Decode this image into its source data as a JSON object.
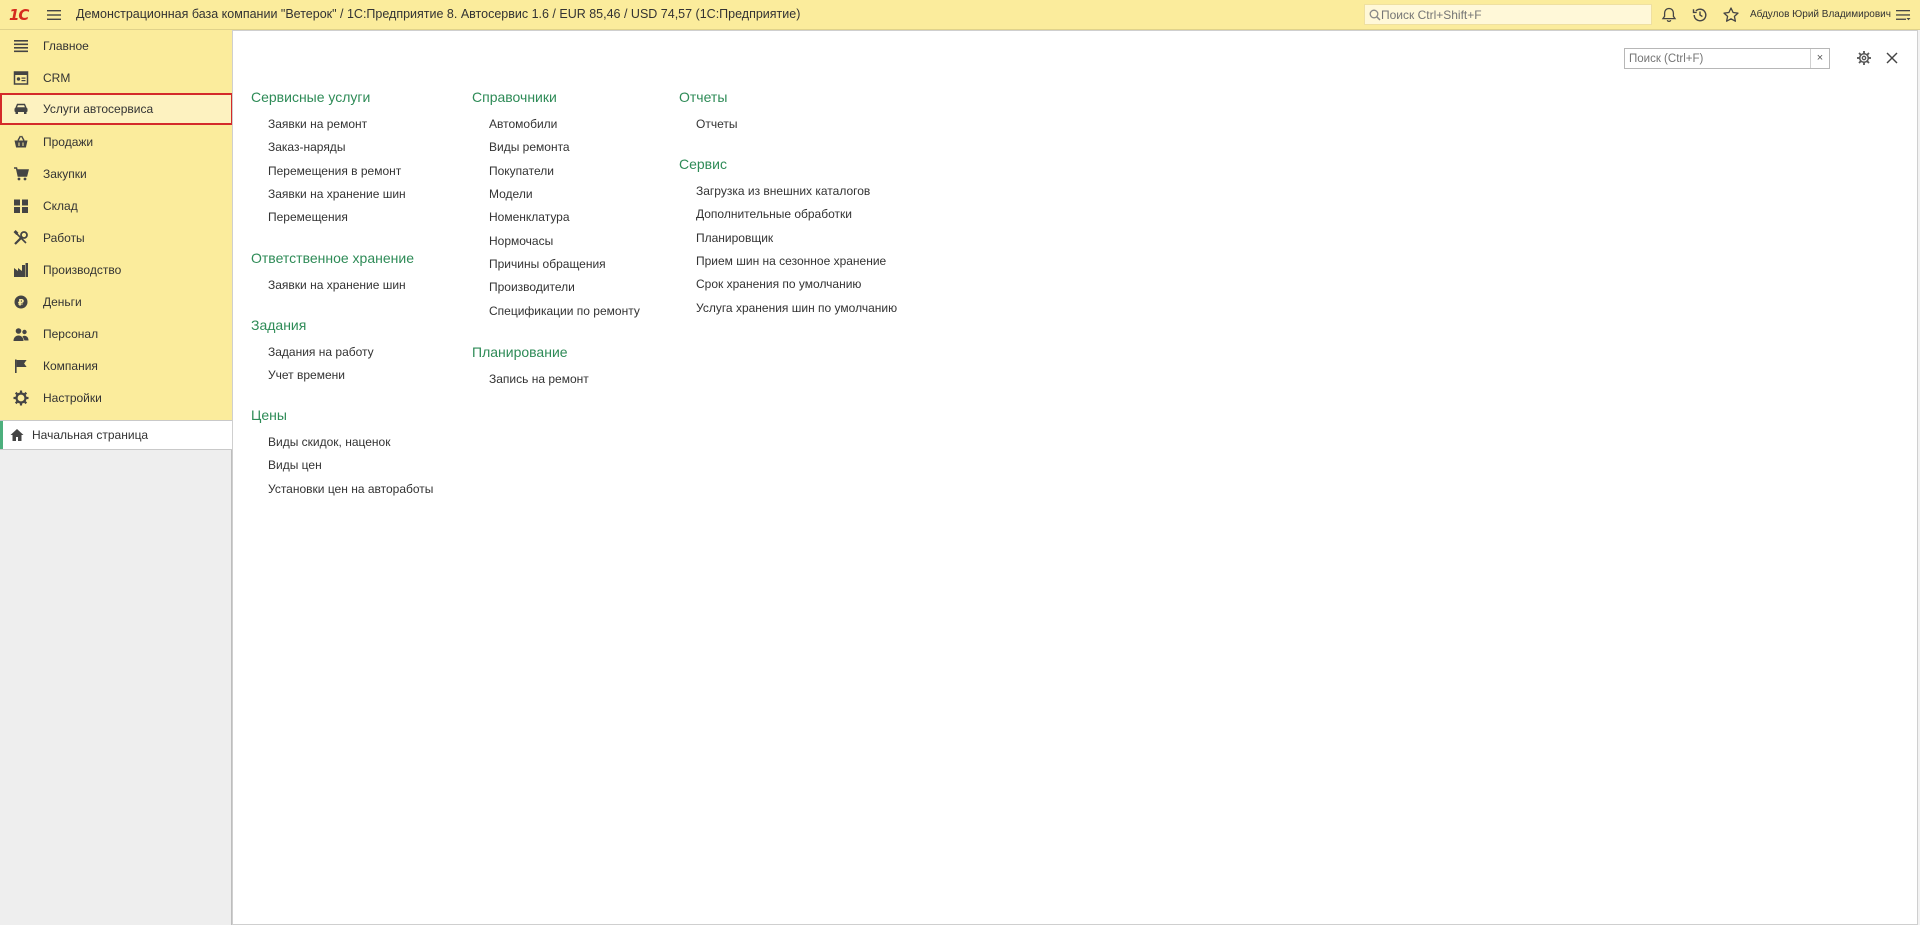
{
  "app": {
    "title": "Демонстрационная база компании \"Ветерок\" / 1С:Предприятие 8. Автосервис 1.6 / EUR 85,46 / USD 74,57  (1С:Предприятие)",
    "logo": "1С",
    "global_search_placeholder": "Поиск Ctrl+Shift+F",
    "user": "Абдулов Юрий Владимирович",
    "icons": [
      "menu-icon",
      "search-icon",
      "bell-icon",
      "history-icon",
      "star-icon",
      "settings-menu-icon"
    ]
  },
  "sidebar": {
    "items": [
      {
        "label": "Главное",
        "icon": "lines-icon"
      },
      {
        "label": "CRM",
        "icon": "crm-icon"
      },
      {
        "label": "Услуги автосервиса",
        "icon": "car-icon"
      },
      {
        "label": "Продажи",
        "icon": "basket-icon"
      },
      {
        "label": "Закупки",
        "icon": "cart-icon"
      },
      {
        "label": "Склад",
        "icon": "grid-icon"
      },
      {
        "label": "Работы",
        "icon": "tools-icon"
      },
      {
        "label": "Производство",
        "icon": "factory-icon"
      },
      {
        "label": "Деньги",
        "icon": "coin-icon"
      },
      {
        "label": "Персонал",
        "icon": "people-icon"
      },
      {
        "label": "Компания",
        "icon": "flag-icon"
      },
      {
        "label": "Настройки",
        "icon": "gear-icon"
      }
    ],
    "active_index": 2,
    "home_page": "Начальная страница"
  },
  "content": {
    "search_placeholder": "Поиск (Ctrl+F)",
    "clear_label": "×",
    "columns": [
      {
        "groups": [
          {
            "title": "Сервисные услуги",
            "links": [
              "Заявки на ремонт",
              "Заказ-наряды",
              "Перемещения в ремонт",
              "Заявки на хранение шин",
              "Перемещения"
            ]
          },
          {
            "title": "Ответственное хранение",
            "links": [
              "Заявки на хранение шин"
            ]
          },
          {
            "title": "Задания",
            "links": [
              "Задания на работу",
              "Учет времени"
            ]
          },
          {
            "title": "Цены",
            "links": [
              "Виды скидок, наценок",
              "Виды цен",
              "Установки цен на автоработы"
            ]
          }
        ]
      },
      {
        "groups": [
          {
            "title": "Справочники",
            "links": [
              "Автомобили",
              "Виды ремонта",
              "Покупатели",
              "Модели",
              "Номенклатура",
              "Нормочасы",
              "Причины обращения",
              "Производители",
              "Спецификации по ремонту"
            ]
          },
          {
            "title": "Планирование",
            "links": [
              "Запись на ремонт"
            ]
          }
        ]
      },
      {
        "groups": [
          {
            "title": "Отчеты",
            "links": [
              "Отчеты"
            ]
          },
          {
            "title": "Сервис",
            "links": [
              "Загрузка из внешних каталогов",
              "Дополнительные обработки",
              "Планировщик",
              "Прием шин на сезонное хранение",
              "Срок хранения по умолчанию",
              "Услуга хранения шин по умолчанию"
            ]
          }
        ]
      }
    ]
  },
  "colors": {
    "topbar": "#fbec9c",
    "sidebar": "#fbec9c",
    "group_title": "#2e8b57",
    "active_border": "#d42a2a",
    "logo": "#d52b1e"
  }
}
